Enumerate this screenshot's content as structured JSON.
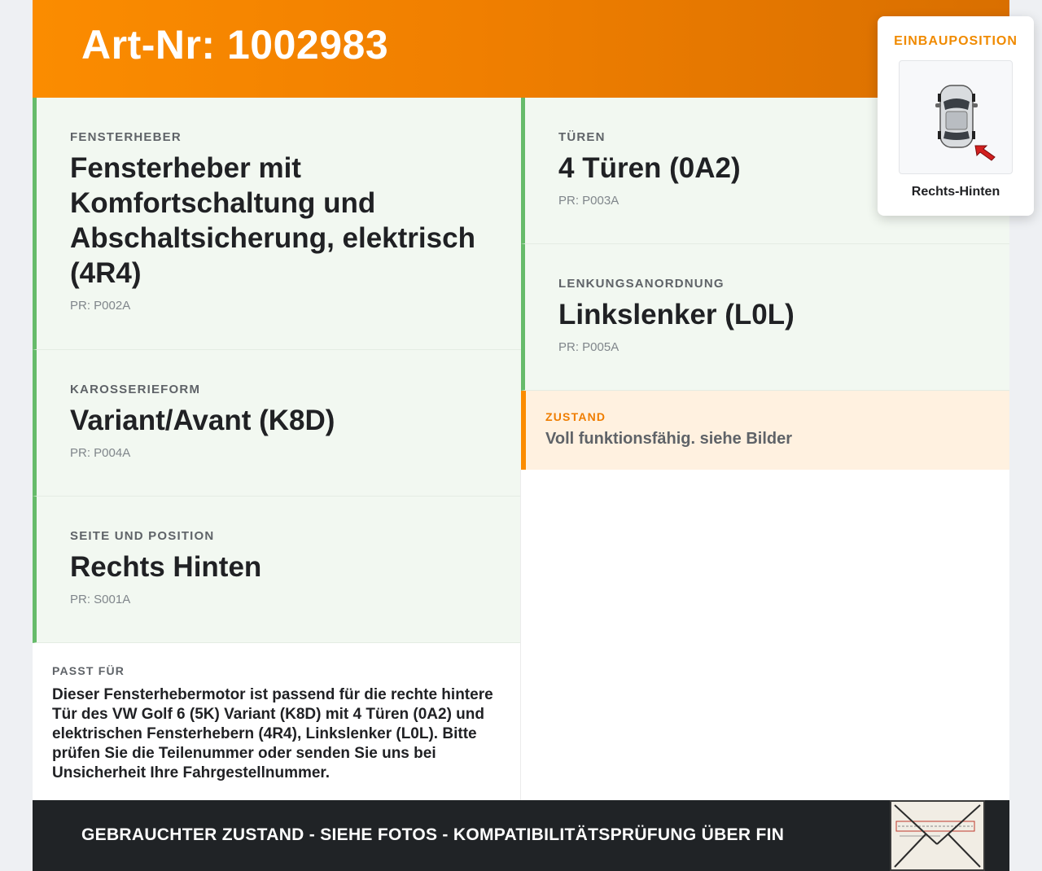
{
  "header": {
    "title": "Art-Nr: 1002983"
  },
  "left_cards": [
    {
      "label": "FENSTERHEBER",
      "value": "Fensterheber mit Komfortschaltung und Abschaltsicherung, elektrisch (4R4)",
      "pr": "PR: P002A"
    },
    {
      "label": "KAROSSERIEFORM",
      "value": "Variant/Avant (K8D)",
      "pr": "PR: P004A"
    },
    {
      "label": "SEITE UND POSITION",
      "value": "Rechts Hinten",
      "pr": "PR: S001A"
    }
  ],
  "right_cards": [
    {
      "label": "TÜREN",
      "value": "4 Türen (0A2)",
      "pr": "PR: P003A"
    },
    {
      "label": "LENKUNGSANORDNUNG",
      "value": "Linkslenker (L0L)",
      "pr": "PR: P005A"
    }
  ],
  "zustand": {
    "label": "ZUSTAND",
    "text": "Voll funktionsfähig. siehe Bilder"
  },
  "passt": {
    "label": "PASST FÜR",
    "text": "Dieser Fensterhebermotor ist passend für die rechte hintere Tür des VW Golf 6 (5K) Variant (K8D) mit 4 Türen (0A2) und elektrischen Fensterhebern (4R4), Linkslenker (L0L). Bitte prüfen Sie die Teilenummer oder senden Sie uns bei Unsicherheit Ihre Fahrgestellnummer."
  },
  "einbau": {
    "label": "EINBAUPOSITION",
    "caption": "Rechts-Hinten",
    "icon": "car-top-view-icon"
  },
  "footer": {
    "text": "GEBRAUCHTER ZUSTAND - SIEHE FOTOS - KOMPATIBILITÄTSPRÜFUNG ÜBER FIN"
  },
  "colors": {
    "accent": "#fb8c00",
    "card_border": "#66bb6a",
    "card_bg": "#f2f8f1",
    "footer_bg": "#202326"
  }
}
